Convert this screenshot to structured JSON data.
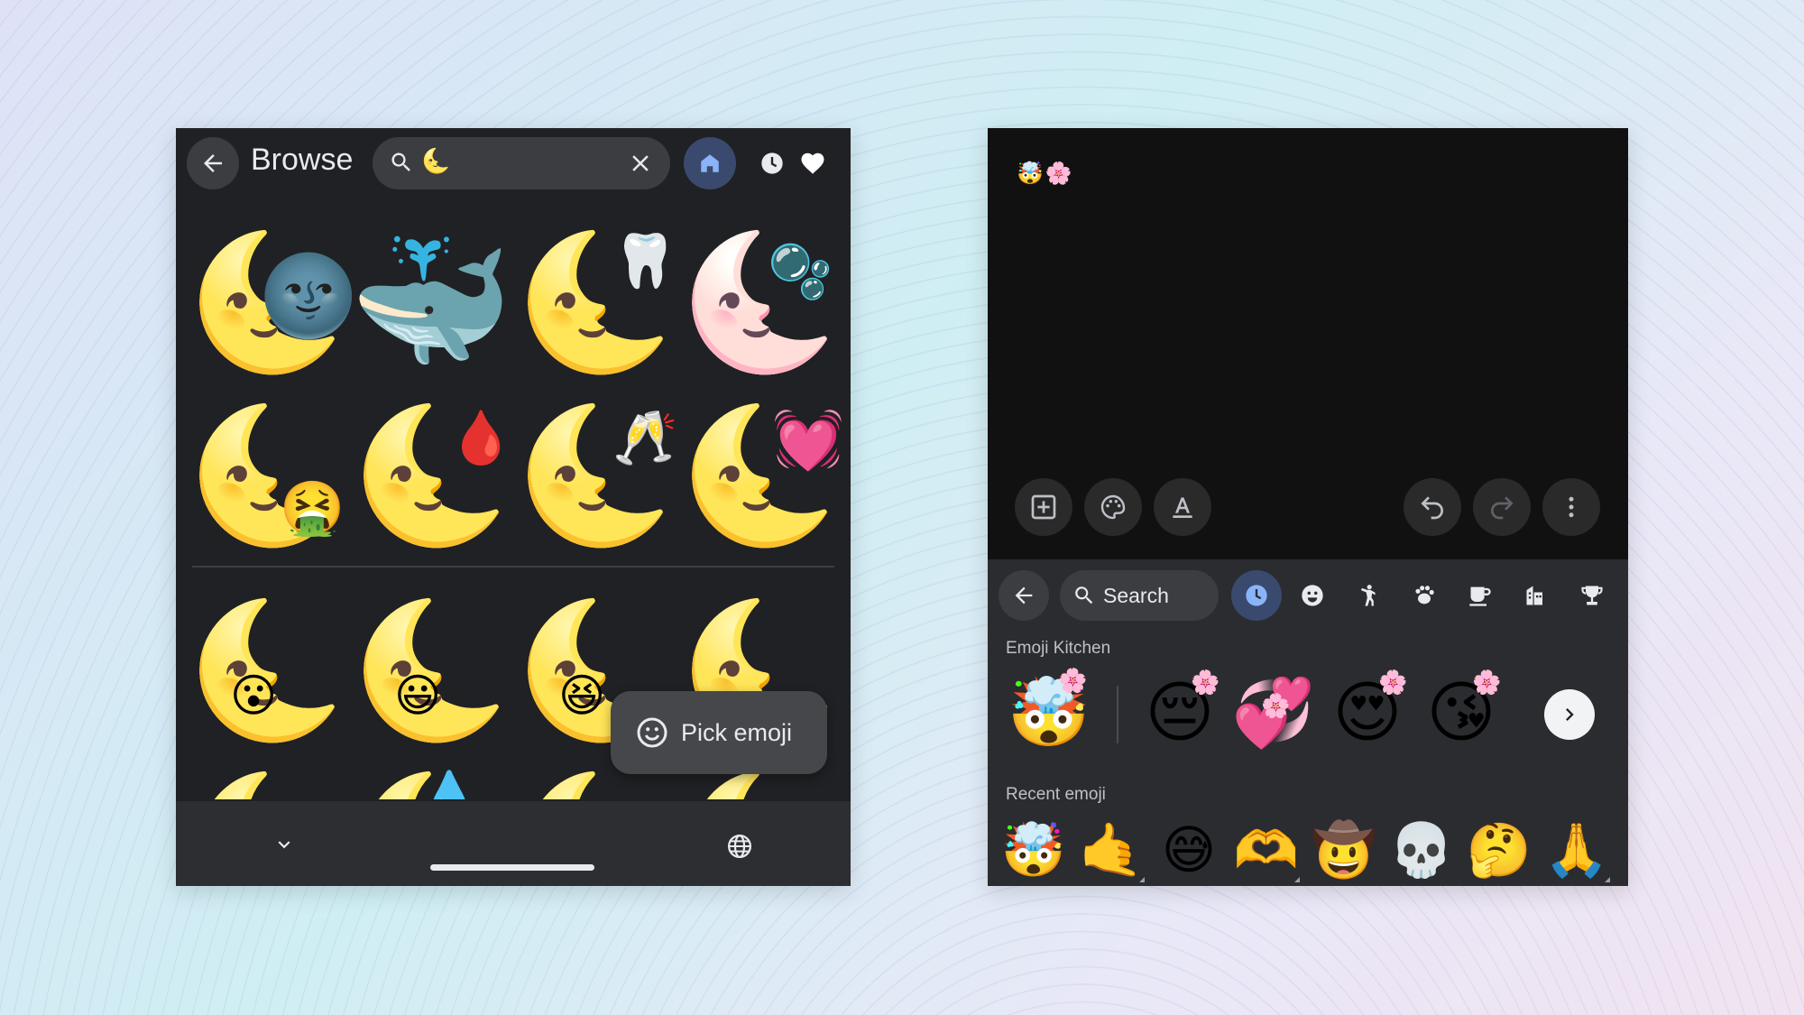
{
  "left": {
    "title": "Browse",
    "search_query": "🌜",
    "grid_row1": [
      {
        "base": "🌜",
        "overlay": "🌚"
      },
      {
        "base": "🐳",
        "overlay": ""
      },
      {
        "base": "🌜",
        "overlay": "🦷"
      },
      {
        "base": "🌜",
        "overlay": "🫧"
      }
    ],
    "grid_row2": [
      {
        "base": "🌜",
        "overlay": "🤮"
      },
      {
        "base": "🌜",
        "overlay": "🩸"
      },
      {
        "base": "🌜",
        "overlay": "🥂"
      },
      {
        "base": "🌜",
        "overlay": "💓"
      }
    ],
    "grid_row3": [
      {
        "base": "🌜",
        "overlay": "😮"
      },
      {
        "base": "🌜",
        "overlay": "😃"
      },
      {
        "base": "🌜",
        "overlay": "😆"
      },
      {
        "base": "🌜",
        "overlay": ""
      }
    ],
    "grid_row4": [
      {
        "base": "🌜",
        "overlay": ""
      },
      {
        "base": "🌜",
        "overlay": "💧"
      },
      {
        "base": "🌜",
        "overlay": ""
      },
      {
        "base": "🌜",
        "overlay": ""
      }
    ],
    "pick_emoji_label": "Pick emoji",
    "icons": {
      "back": "arrow-back-icon",
      "search": "search-icon",
      "clear": "close-icon",
      "home": "home-icon",
      "recent": "clock-icon",
      "favorites": "heart-icon",
      "collapse": "chevron-down-icon",
      "language": "globe-icon",
      "pick": "smiley-icon"
    },
    "accent_color": "#8ab4f8"
  },
  "right": {
    "canvas_text": "🤯🌸",
    "search_placeholder": "Search",
    "emoji_kitchen_label": "Emoji Kitchen",
    "recent_emoji_label": "Recent emoji",
    "kitchen_source": "🤯",
    "kitchen_results": [
      {
        "base": "😔",
        "sub": "🌸"
      },
      {
        "base": "💞",
        "sub": "🌸"
      },
      {
        "base": "😍",
        "sub": "🌸"
      },
      {
        "base": "😘",
        "sub": "🌸"
      }
    ],
    "recent_emojis": [
      "🤯",
      "🤙",
      "😅",
      "🫶",
      "🤠",
      "💀",
      "🤔",
      "🙏"
    ],
    "categories": [
      "recent-icon",
      "smileys-icon",
      "people-icon",
      "animals-icon",
      "food-icon",
      "travel-icon",
      "activities-icon"
    ],
    "tools": [
      "add-box-icon",
      "palette-icon",
      "text-format-icon",
      "undo-icon",
      "redo-icon",
      "more-vert-icon"
    ]
  }
}
